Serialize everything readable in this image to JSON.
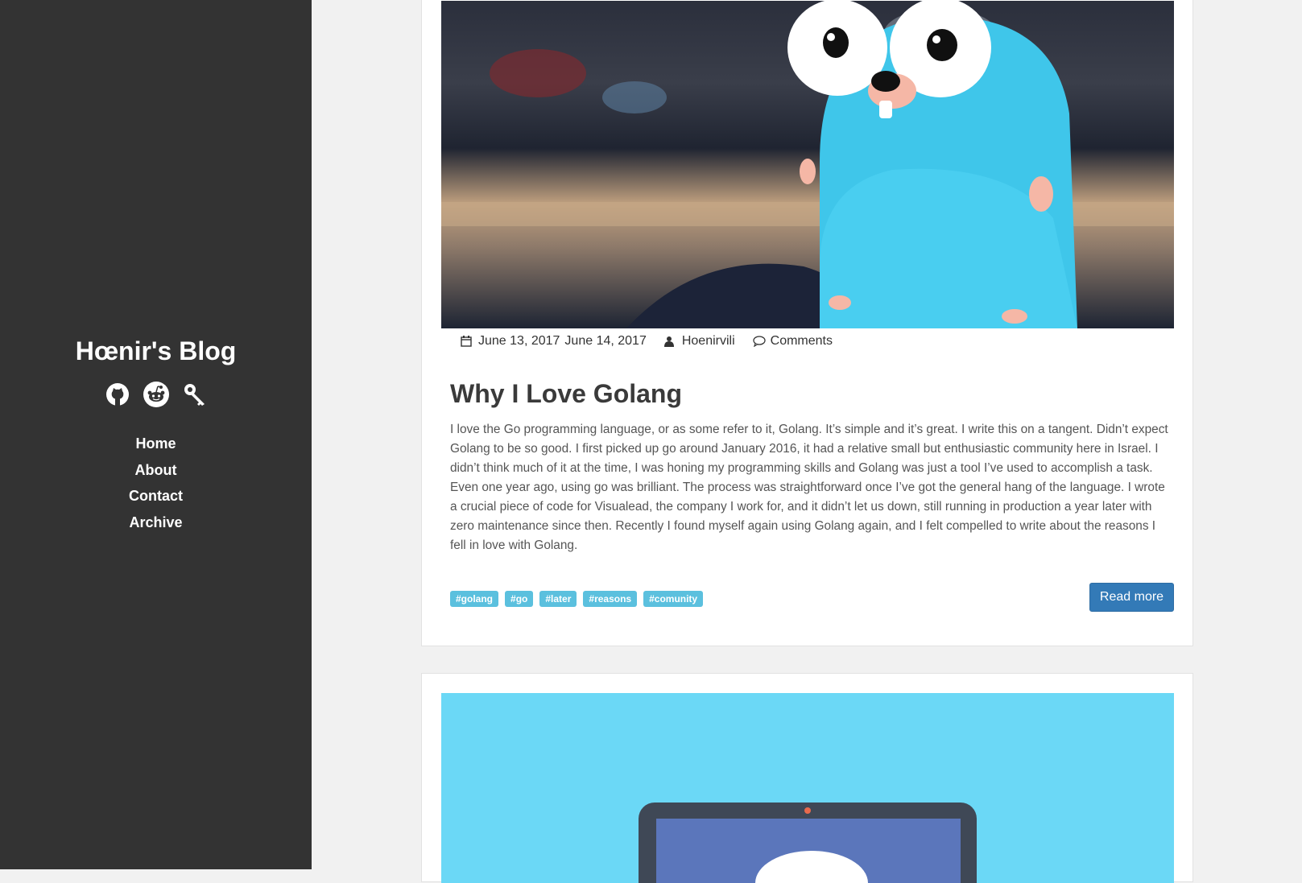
{
  "sidebar": {
    "blog_title": "Hœnir's Blog",
    "social_icons": [
      "github-icon",
      "reddit-icon",
      "keybase-icon"
    ],
    "nav": [
      "Home",
      "About",
      "Contact",
      "Archive"
    ]
  },
  "post": {
    "date_published": "June 13, 2017",
    "date_updated": "June 14, 2017",
    "author": "Hoenirvili",
    "comments_label": "Comments",
    "title": "Why I Love Golang",
    "excerpt": "I love the Go programming language, or as some refer to it, Golang. It’s simple and it’s great. I write this on a tangent. Didn’t expect Golang to be so good. I first picked up go around January 2016, it had a relative small but enthusiastic community here in Israel. I didn’t think much of it at the time, I was honing my programming skills and Golang was just a tool I’ve used to accomplish a task. Even one year ago, using go was brilliant. The process was straightforward once I’ve got the general hang of the language. I wrote a crucial piece of code for Visualead, the company I work for, and it didn’t let us down, still running in production a year later with zero maintenance since then. Recently I found myself again using Golang again, and I felt compelled to write about the reasons I fell in love with Golang.",
    "tags": [
      "#golang",
      "#go",
      "#later",
      "#reasons",
      "#comunity"
    ],
    "read_more_label": "Read more"
  },
  "colors": {
    "sidebar_bg": "#333333",
    "page_bg": "#f1f1f1",
    "tag_bg": "#5bc0de",
    "button_bg": "#337ab7",
    "hero2_bg": "#6bd8f6"
  }
}
